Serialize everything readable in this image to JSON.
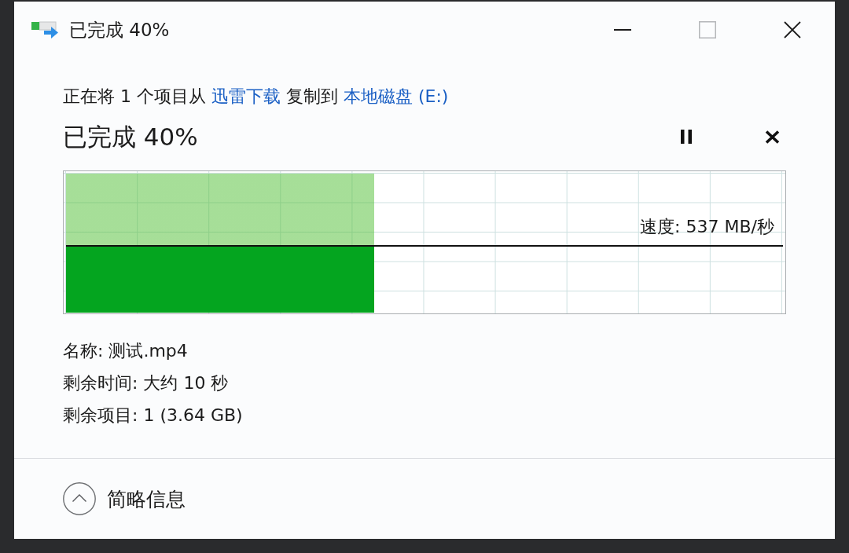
{
  "window": {
    "title": "已完成 40%"
  },
  "copy_description": {
    "parts": [
      {
        "kind": "text",
        "text": "正在将 1 个项目从"
      },
      {
        "kind": "link",
        "text": "迅雷下载"
      },
      {
        "kind": "text",
        "text": "复制到"
      },
      {
        "kind": "link",
        "text": "本地磁盘 (E:)"
      }
    ]
  },
  "progress": {
    "heading": "已完成 40%",
    "level": 0.43,
    "speed": "速度: 537 MB/秒"
  },
  "details": [
    "名称: 测试.mp4",
    "剩余时间: 大约 10 秒",
    "剩余项目: 1 (3.64 GB)"
  ],
  "footer": {
    "toggle_label": "简略信息",
    "expanded": true
  }
}
